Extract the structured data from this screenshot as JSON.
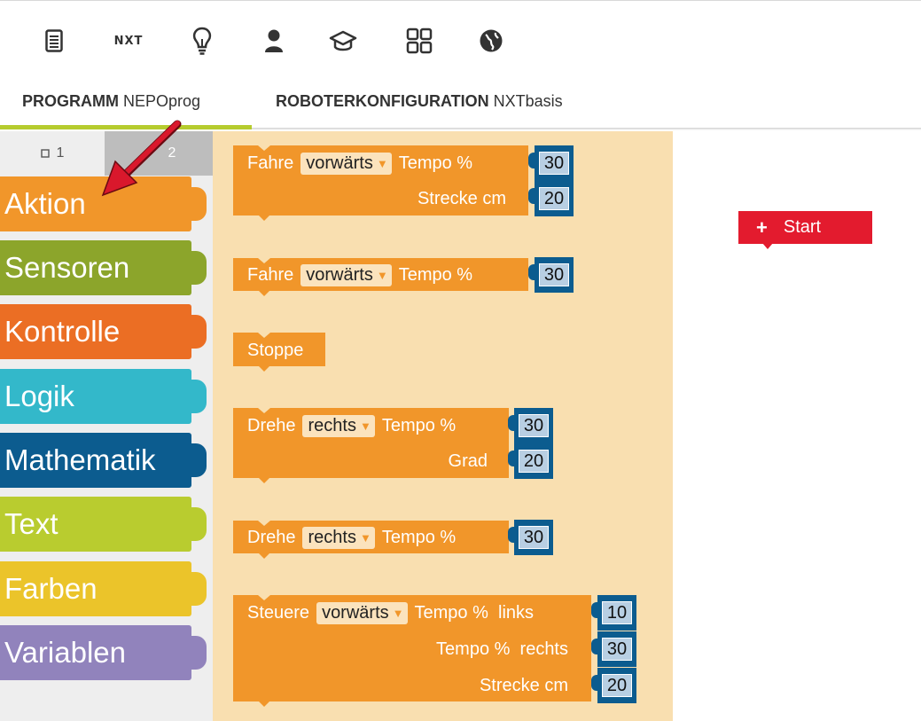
{
  "topbar": {
    "icons": [
      "document-icon",
      "robot-nxt-icon",
      "lightbulb-icon",
      "user-icon",
      "graduation-cap-icon",
      "gallery-grid-icon",
      "globe-icon"
    ],
    "robot_label": "nxt"
  },
  "tabs": {
    "program": {
      "label": "PROGRAMM",
      "name": "NEPOprog"
    },
    "config": {
      "label": "ROBOTERKONFIGURATION",
      "name": "NXTbasis"
    }
  },
  "toolbox": {
    "levels": [
      "1",
      "2"
    ],
    "categories": [
      {
        "label": "Aktion",
        "color": "#f1962a"
      },
      {
        "label": "Sensoren",
        "color": "#8ca52b"
      },
      {
        "label": "Kontrolle",
        "color": "#eb6e24"
      },
      {
        "label": "Logik",
        "color": "#33b8ca"
      },
      {
        "label": "Mathematik",
        "color": "#0c5c8f"
      },
      {
        "label": "Text",
        "color": "#b9cc2f"
      },
      {
        "label": "Farben",
        "color": "#ebc42a"
      },
      {
        "label": "Variablen",
        "color": "#9183bc"
      }
    ]
  },
  "flyout": {
    "block1": {
      "label": "Fahre",
      "dropdown": "vorwärts",
      "param1": "Tempo %",
      "value1": "30",
      "param2": "Strecke cm",
      "value2": "20"
    },
    "block2": {
      "label": "Fahre",
      "dropdown": "vorwärts",
      "param1": "Tempo %",
      "value1": "30"
    },
    "block3": {
      "label": "Stoppe"
    },
    "block4": {
      "label": "Drehe",
      "dropdown": "rechts",
      "param1": "Tempo %",
      "value1": "30",
      "param2": "Grad",
      "value2": "20"
    },
    "block5": {
      "label": "Drehe",
      "dropdown": "rechts",
      "param1": "Tempo %",
      "value1": "30"
    },
    "block6": {
      "label": "Steuere",
      "dropdown": "vorwärts",
      "param1": "Tempo %  links",
      "value1": "10",
      "param2": "Tempo %  rechts",
      "value2": "30",
      "param3": "Strecke cm",
      "value3": "20"
    }
  },
  "workspace": {
    "start_label": "Start"
  },
  "colors": {
    "action": "#f1962a",
    "start": "#e31b2e",
    "value": "#0c5c8f",
    "tab_underline": "#b6cc2e",
    "pointer_arrow": "#d9182c"
  }
}
